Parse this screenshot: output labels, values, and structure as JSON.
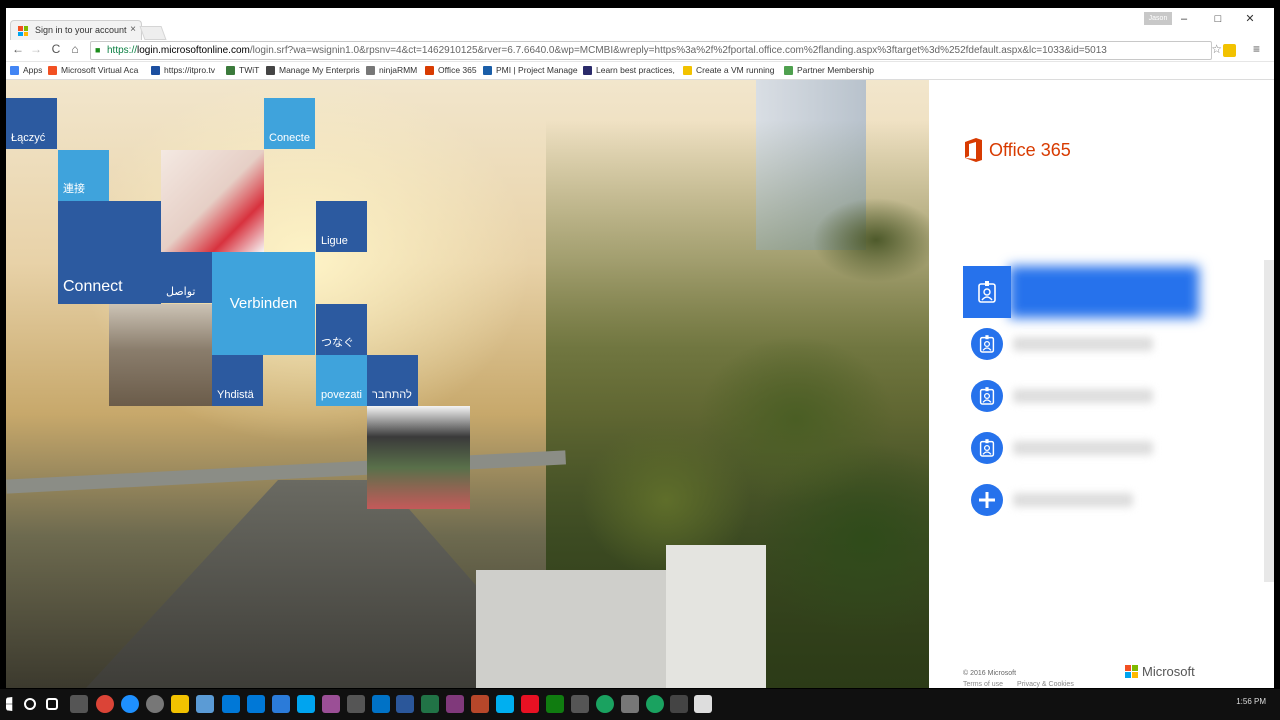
{
  "browser": {
    "tab_title": "Sign in to your account",
    "tab_close": "×",
    "window_user_chip": "Jason",
    "minimize": "–",
    "maximize": "□",
    "close": "✕",
    "url_scheme": "https://",
    "url_host": "login.microsoftonline.com",
    "url_rest": "/login.srf?wa=wsignin1.0&rpsnv=4&ct=1462910125&rver=6.7.6640.0&wp=MCMBI&wreply=https%3a%2f%2fportal.office.com%2flanding.aspx%3ftarget%3d%252fdefault.aspx&lc=1033&id=5013",
    "back": "←",
    "forward": "→",
    "reload": "C",
    "home": "⌂",
    "star": "☆",
    "menu": "≡"
  },
  "bookmarks": [
    {
      "label": "Apps",
      "icon": "apps-grid-icon",
      "color": "#4285f4"
    },
    {
      "label": "Microsoft Virtual Aca",
      "icon": "microsoft-icon",
      "color": "#f25022"
    },
    {
      "label": "https://itpro.tv",
      "icon": "itprotv-icon",
      "color": "#1c4fa0"
    },
    {
      "label": "TWiT",
      "icon": "twit-icon",
      "color": "#3b7a3b"
    },
    {
      "label": "Manage My Enterpris",
      "icon": "enterprise-icon",
      "color": "#444444"
    },
    {
      "label": "ninjaRMM",
      "icon": "ninja-icon",
      "color": "#777777"
    },
    {
      "label": "Office 365",
      "icon": "office-icon",
      "color": "#d83b01"
    },
    {
      "label": "PMI | Project Manage",
      "icon": "pmi-icon",
      "color": "#1a5ea8"
    },
    {
      "label": "Learn best practices, ",
      "icon": "learn-icon",
      "color": "#2a2a6a"
    },
    {
      "label": "Create a VM running",
      "icon": "azure-icon",
      "color": "#f2c200"
    },
    {
      "label": "Partner Membership",
      "icon": "partner-icon",
      "color": "#4fa04f"
    }
  ],
  "tiles": {
    "laczyc": "Łączyć",
    "lianjie": "連接",
    "conecte": "Conecte",
    "ligue": "Ligue",
    "connect": "Connect",
    "tawasal": "تواصل",
    "verbinden": "Verbinden",
    "tsunagu": "つなぐ",
    "yhdista": "Yhdistä",
    "povezati": "povezati",
    "hebrew": "להתחבר"
  },
  "signin": {
    "product": "Office 365",
    "copyright": "© 2016 Microsoft",
    "terms": "Terms of use",
    "privacy": "Privacy & Cookies",
    "microsoft": "Microsoft",
    "accounts": [
      {
        "icon": "account-badge-icon",
        "selected": true
      },
      {
        "icon": "account-badge-icon",
        "selected": false
      },
      {
        "icon": "account-badge-icon",
        "selected": false
      },
      {
        "icon": "account-badge-icon",
        "selected": false
      }
    ],
    "add_account_icon": "plus-icon"
  },
  "taskbar": {
    "time": "1:56 PM"
  },
  "colors": {
    "office_orange": "#d83b01",
    "account_blue": "#2672ec",
    "tile_dark_blue": "#2c5aa0",
    "tile_light_blue": "#3fa3dc"
  }
}
